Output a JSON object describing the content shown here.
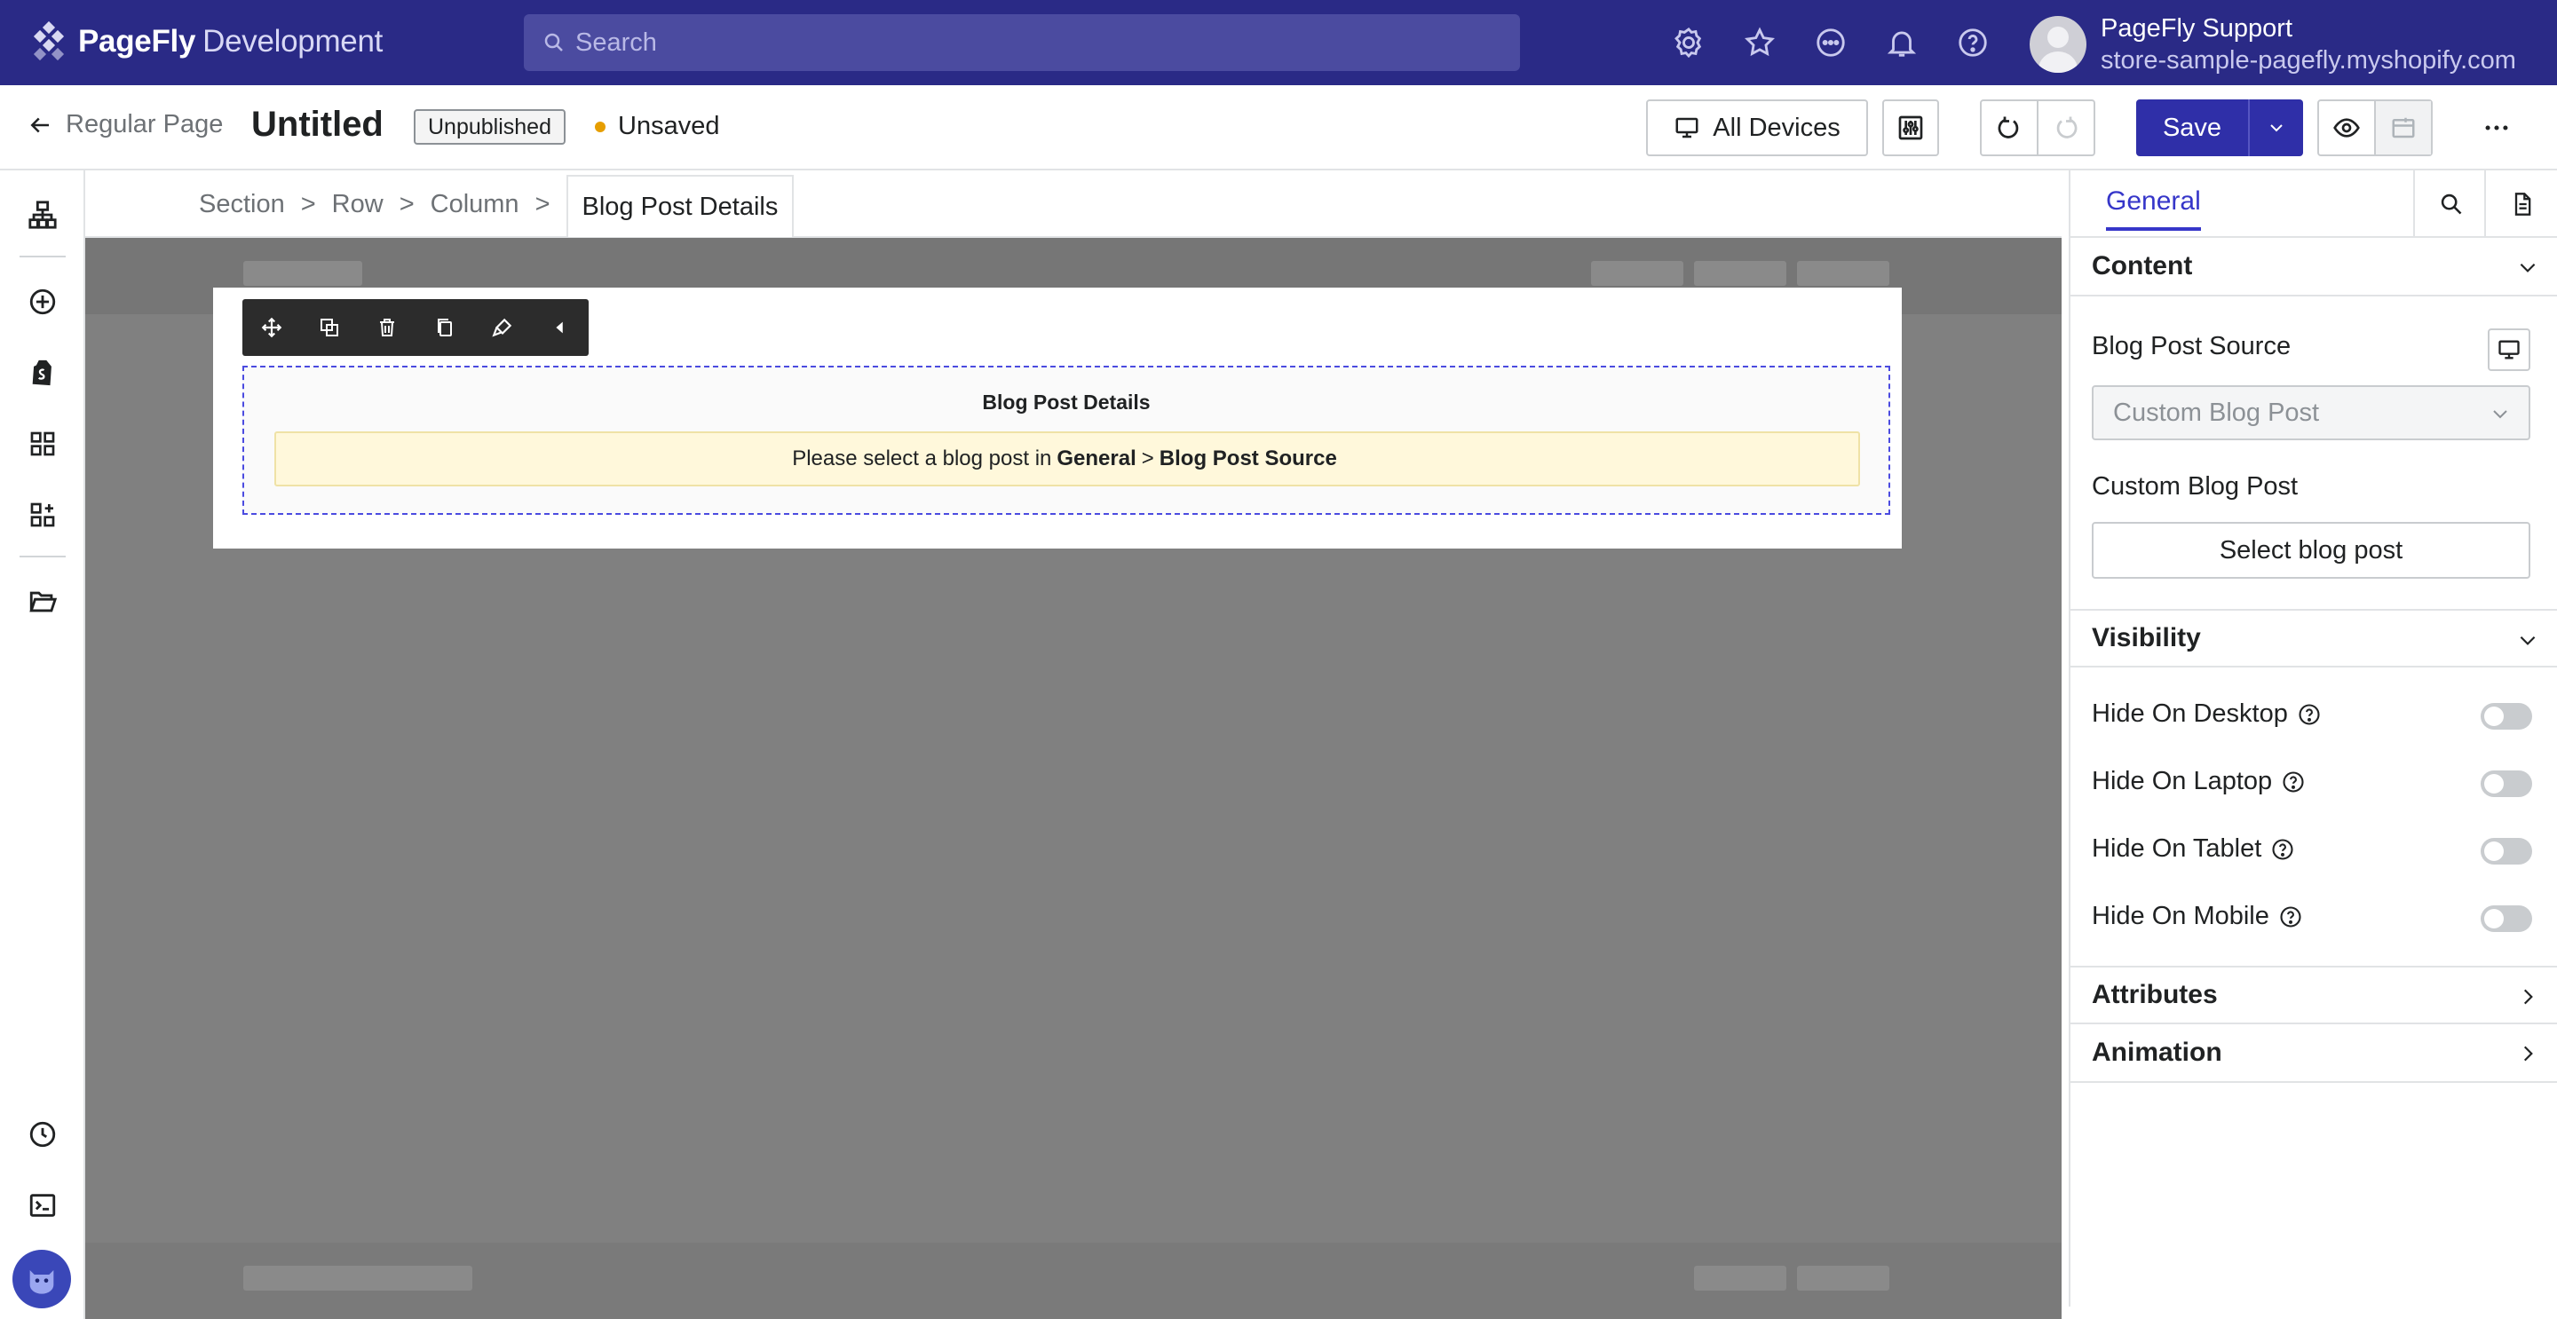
{
  "app": {
    "brand": "PageFly",
    "env": "Development",
    "search_placeholder": "Search",
    "user": {
      "name": "PageFly Support",
      "store": "store-sample-pagefly.myshopify.com"
    }
  },
  "subbar": {
    "back_label": "Regular Page",
    "title": "Untitled",
    "status_badge": "Unpublished",
    "save_state": "Unsaved",
    "devices_label": "All Devices",
    "save_label": "Save"
  },
  "breadcrumb": {
    "items": [
      "Section",
      "Row",
      "Column"
    ],
    "current": "Blog Post Details"
  },
  "element": {
    "title": "Blog Post Details",
    "note_prefix": "Please select a blog post in",
    "note_general": "General",
    "note_sep": ">",
    "note_source": "Blog Post Source"
  },
  "panel": {
    "tab": "General",
    "content": {
      "heading": "Content",
      "source_label": "Blog Post Source",
      "source_value": "Custom Blog Post",
      "custom_label": "Custom Blog Post",
      "select_button": "Select blog post"
    },
    "visibility": {
      "heading": "Visibility",
      "items": [
        {
          "label": "Hide On Desktop",
          "on": false
        },
        {
          "label": "Hide On Laptop",
          "on": false
        },
        {
          "label": "Hide On Tablet",
          "on": false
        },
        {
          "label": "Hide On Mobile",
          "on": false
        }
      ]
    },
    "attributes_heading": "Attributes",
    "animation_heading": "Animation"
  },
  "colors": {
    "topbar": "#2a2a86",
    "accent": "#3636c9",
    "save": "#2f2fa8",
    "unsaved_dot": "#e69e00"
  }
}
